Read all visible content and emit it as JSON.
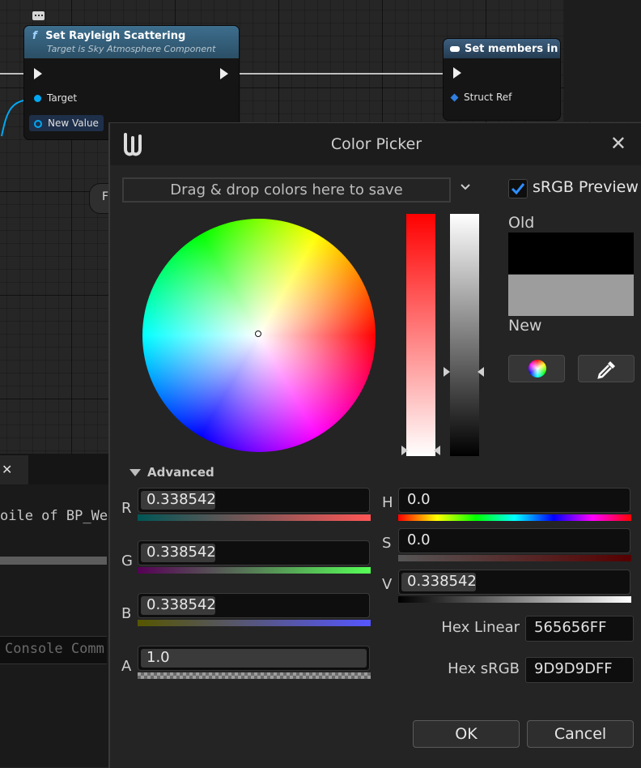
{
  "graph": {
    "node1": {
      "title": "Set Rayleigh Scattering",
      "subtitle": "Target is Sky Atmosphere Component",
      "pins": [
        "Target",
        "New Value"
      ]
    },
    "node2": {
      "title": "Set members in Po",
      "pins": [
        "Struct Ref"
      ]
    },
    "partial_node_letter": "F"
  },
  "bottom_panel": {
    "log_line": "oile of BP_We",
    "console_placeholder": "Console Comm"
  },
  "color_picker": {
    "title": "Color Picker",
    "drop_zone": "Drag & drop colors here to save",
    "srgb_preview": {
      "label": "sRGB Preview",
      "checked": true
    },
    "old_label": "Old",
    "new_label": "New",
    "old_color": "#000000",
    "new_color": "#9D9D9D",
    "advanced_label": "Advanced",
    "channels": {
      "r": {
        "label": "R",
        "value": "0.338542"
      },
      "g": {
        "label": "G",
        "value": "0.338542"
      },
      "b": {
        "label": "B",
        "value": "0.338542"
      },
      "a": {
        "label": "A",
        "value": "1.0"
      },
      "h": {
        "label": "H",
        "value": "0.0"
      },
      "s": {
        "label": "S",
        "value": "0.0"
      },
      "v": {
        "label": "V",
        "value": "0.338542"
      }
    },
    "hex_linear": {
      "label": "Hex Linear",
      "value": "565656FF"
    },
    "hex_srgb": {
      "label": "Hex sRGB",
      "value": "9D9D9DFF"
    },
    "ok_label": "OK",
    "cancel_label": "Cancel"
  }
}
